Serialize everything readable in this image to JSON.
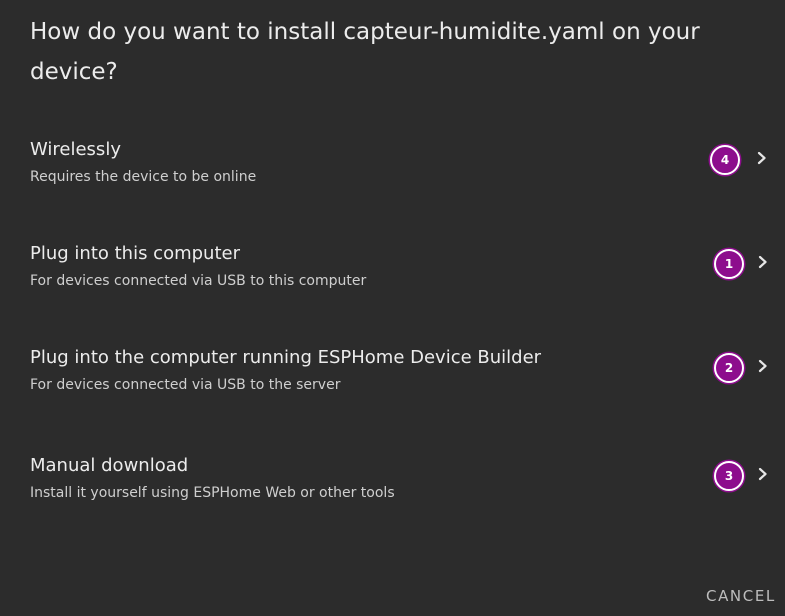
{
  "dialog": {
    "title": "How do you want to install capteur-humidite.yaml on your device?",
    "options": [
      {
        "title": "Wirelessly",
        "subtitle": "Requires the device to be online",
        "badge": "4"
      },
      {
        "title": "Plug into this computer",
        "subtitle": "For devices connected via USB to this computer",
        "badge": "1"
      },
      {
        "title": "Plug into the computer running ESPHome Device Builder",
        "subtitle": "For devices connected via USB to the server",
        "badge": "2"
      },
      {
        "title": "Manual download",
        "subtitle": "Install it yourself using ESPHome Web or other tools",
        "badge": "3"
      }
    ],
    "cancel_label": "CANCEL"
  },
  "icons": {
    "option_arrow": "chevron-right-icon"
  },
  "colors": {
    "background": "#2c2c2c",
    "badge": "#8d0d8d",
    "text": "#ececec"
  }
}
